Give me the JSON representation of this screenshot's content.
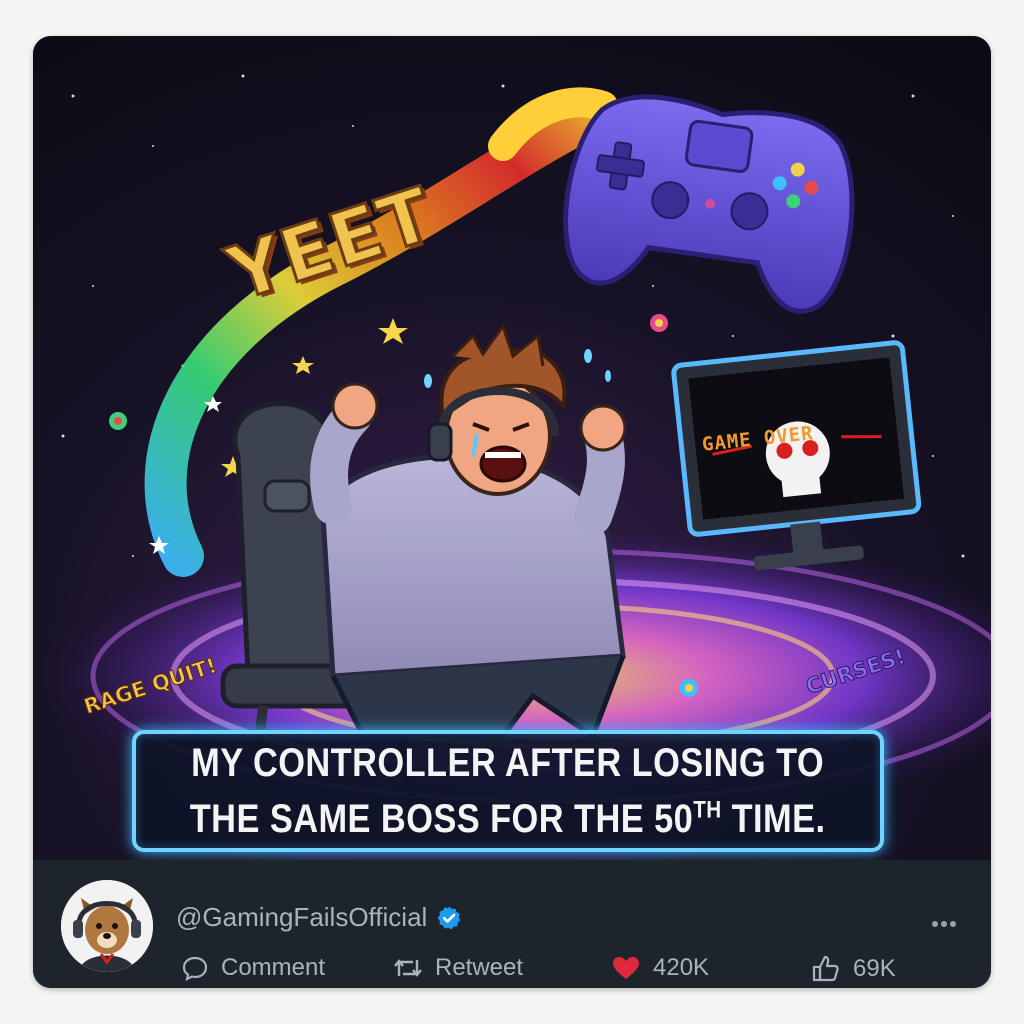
{
  "meme": {
    "caption_line1": "MY CONTROLLER AFTER LOSING TO",
    "caption_line2_prefix": "THE SAME BOSS FOR THE 50",
    "caption_line2_sup": "TH",
    "caption_line2_suffix": " TIME.",
    "yeet_text": "YEET",
    "rage_quit_text": "RAGE QUIT!",
    "curses_text": "CURSES!",
    "game_over_text": "GAME OVER"
  },
  "post": {
    "handle": "@GamingFailsOfficial",
    "verified": true,
    "more_icon": "ellipsis-icon",
    "actions": {
      "comment_label": "Comment",
      "retweet_label": "Retweet",
      "likes_count": "420K",
      "thumbs_count": "69K"
    }
  },
  "colors": {
    "caption_border": "#6fd4ff",
    "like_heart": "#e0283c",
    "verified_badge": "#1d9bf0",
    "footer_bg": "#1d242c"
  }
}
